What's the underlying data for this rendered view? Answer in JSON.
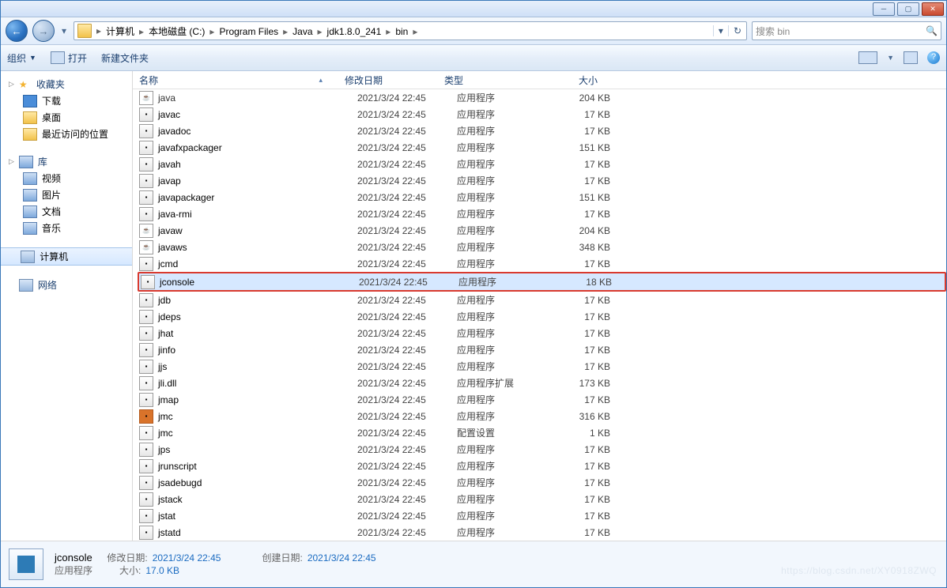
{
  "breadcrumb": [
    "计算机",
    "本地磁盘 (C:)",
    "Program Files",
    "Java",
    "jdk1.8.0_241",
    "bin"
  ],
  "search_placeholder": "搜索 bin",
  "toolbar": {
    "organize": "组织",
    "open": "打开",
    "newfolder": "新建文件夹"
  },
  "columns": {
    "name": "名称",
    "date": "修改日期",
    "type": "类型",
    "size": "大小"
  },
  "sidebar": {
    "fav": "收藏夹",
    "fav_items": [
      "下载",
      "桌面",
      "最近访问的位置"
    ],
    "lib": "库",
    "lib_items": [
      "视频",
      "图片",
      "文档",
      "音乐"
    ],
    "computer": "计算机",
    "network": "网络"
  },
  "type_app": "应用程序",
  "type_ext": "应用程序扩展",
  "type_cfg": "配置设置",
  "files": [
    {
      "n": "java",
      "d": "2021/3/24 22:45",
      "t": "app",
      "s": "204 KB",
      "i": "java",
      "cut": true
    },
    {
      "n": "javac",
      "d": "2021/3/24 22:45",
      "t": "app",
      "s": "17 KB",
      "i": "exe"
    },
    {
      "n": "javadoc",
      "d": "2021/3/24 22:45",
      "t": "app",
      "s": "17 KB",
      "i": "exe"
    },
    {
      "n": "javafxpackager",
      "d": "2021/3/24 22:45",
      "t": "app",
      "s": "151 KB",
      "i": "exe"
    },
    {
      "n": "javah",
      "d": "2021/3/24 22:45",
      "t": "app",
      "s": "17 KB",
      "i": "exe"
    },
    {
      "n": "javap",
      "d": "2021/3/24 22:45",
      "t": "app",
      "s": "17 KB",
      "i": "exe"
    },
    {
      "n": "javapackager",
      "d": "2021/3/24 22:45",
      "t": "app",
      "s": "151 KB",
      "i": "exe"
    },
    {
      "n": "java-rmi",
      "d": "2021/3/24 22:45",
      "t": "app",
      "s": "17 KB",
      "i": "exe"
    },
    {
      "n": "javaw",
      "d": "2021/3/24 22:45",
      "t": "app",
      "s": "204 KB",
      "i": "java"
    },
    {
      "n": "javaws",
      "d": "2021/3/24 22:45",
      "t": "app",
      "s": "348 KB",
      "i": "java"
    },
    {
      "n": "jcmd",
      "d": "2021/3/24 22:45",
      "t": "app",
      "s": "17 KB",
      "i": "exe"
    },
    {
      "n": "jconsole",
      "d": "2021/3/24 22:45",
      "t": "app",
      "s": "18 KB",
      "i": "exe",
      "sel": true
    },
    {
      "n": "jdb",
      "d": "2021/3/24 22:45",
      "t": "app",
      "s": "17 KB",
      "i": "exe"
    },
    {
      "n": "jdeps",
      "d": "2021/3/24 22:45",
      "t": "app",
      "s": "17 KB",
      "i": "exe"
    },
    {
      "n": "jhat",
      "d": "2021/3/24 22:45",
      "t": "app",
      "s": "17 KB",
      "i": "exe"
    },
    {
      "n": "jinfo",
      "d": "2021/3/24 22:45",
      "t": "app",
      "s": "17 KB",
      "i": "exe"
    },
    {
      "n": "jjs",
      "d": "2021/3/24 22:45",
      "t": "app",
      "s": "17 KB",
      "i": "exe"
    },
    {
      "n": "jli.dll",
      "d": "2021/3/24 22:45",
      "t": "ext",
      "s": "173 KB",
      "i": "cfg"
    },
    {
      "n": "jmap",
      "d": "2021/3/24 22:45",
      "t": "app",
      "s": "17 KB",
      "i": "exe"
    },
    {
      "n": "jmc",
      "d": "2021/3/24 22:45",
      "t": "app",
      "s": "316 KB",
      "i": "jmc"
    },
    {
      "n": "jmc",
      "d": "2021/3/24 22:45",
      "t": "cfg",
      "s": "1 KB",
      "i": "cfg"
    },
    {
      "n": "jps",
      "d": "2021/3/24 22:45",
      "t": "app",
      "s": "17 KB",
      "i": "exe"
    },
    {
      "n": "jrunscript",
      "d": "2021/3/24 22:45",
      "t": "app",
      "s": "17 KB",
      "i": "exe"
    },
    {
      "n": "jsadebugd",
      "d": "2021/3/24 22:45",
      "t": "app",
      "s": "17 KB",
      "i": "exe"
    },
    {
      "n": "jstack",
      "d": "2021/3/24 22:45",
      "t": "app",
      "s": "17 KB",
      "i": "exe"
    },
    {
      "n": "jstat",
      "d": "2021/3/24 22:45",
      "t": "app",
      "s": "17 KB",
      "i": "exe"
    },
    {
      "n": "jstatd",
      "d": "2021/3/24 22:45",
      "t": "app",
      "s": "17 KB",
      "i": "exe"
    }
  ],
  "details": {
    "name": "jconsole",
    "type": "应用程序",
    "mod_label": "修改日期:",
    "mod": "2021/3/24 22:45",
    "size_label": "大小:",
    "size": "17.0 KB",
    "create_label": "创建日期:",
    "create": "2021/3/24 22:45"
  },
  "watermark": "https://blog.csdn.net/XY0918ZWQ"
}
